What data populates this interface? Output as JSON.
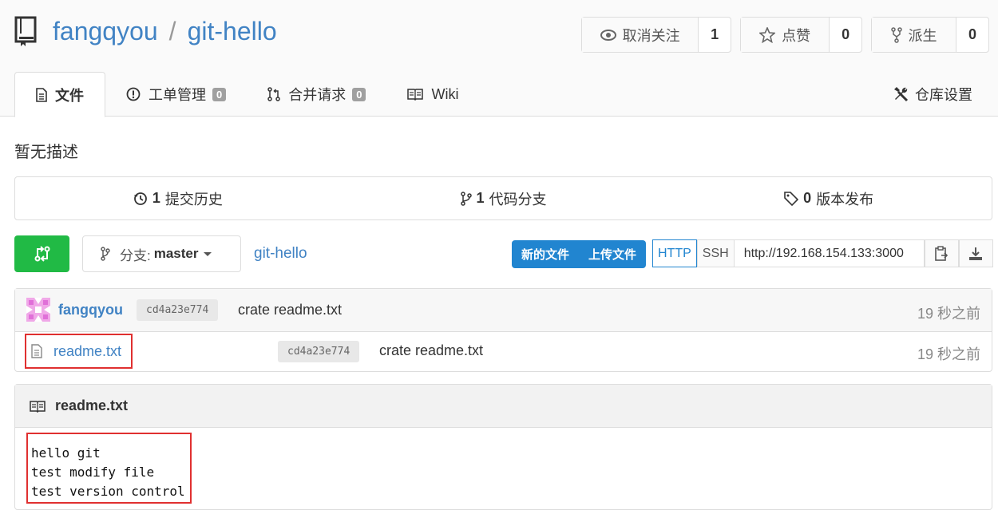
{
  "repo": {
    "owner": "fangqyou",
    "separator": "/",
    "name": "git-hello"
  },
  "actions": [
    {
      "label": "取消关注",
      "count": "1",
      "icon": "eye-icon"
    },
    {
      "label": "点赞",
      "count": "0",
      "icon": "star-icon"
    },
    {
      "label": "派生",
      "count": "0",
      "icon": "fork-icon"
    }
  ],
  "tabs": {
    "files": "文件",
    "issues": {
      "label": "工单管理",
      "badge": "0"
    },
    "pulls": {
      "label": "合并请求",
      "badge": "0"
    },
    "wiki": "Wiki",
    "settings": "仓库设置"
  },
  "description": "暂无描述",
  "stats": {
    "commits": {
      "count": "1",
      "label": "提交历史"
    },
    "branches": {
      "count": "1",
      "label": "代码分支"
    },
    "releases": {
      "count": "0",
      "label": "版本发布"
    }
  },
  "branch": {
    "prefix": "分支:",
    "name": "master"
  },
  "breadcrumb": "git-hello",
  "file_buttons": {
    "new_file": "新的文件",
    "upload": "上传文件"
  },
  "clone": {
    "http": "HTTP",
    "ssh": "SSH",
    "url": "http://192.168.154.133:3000"
  },
  "latest_commit": {
    "author": "fangqyou",
    "sha": "cd4a23e774",
    "message": "crate readme.txt",
    "time": "19 秒之前"
  },
  "files": [
    {
      "name": "readme.txt",
      "sha": "cd4a23e774",
      "message": "crate readme.txt",
      "time": "19 秒之前"
    }
  ],
  "readme": {
    "title": "readme.txt",
    "lines": [
      "hello git",
      "test modify file",
      "test version control"
    ]
  },
  "colors": {
    "link": "#4183c4",
    "green": "#21ba45",
    "blue": "#2185d0",
    "highlight": "#e03030"
  }
}
